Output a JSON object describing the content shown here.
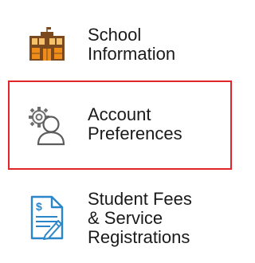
{
  "menu": {
    "items": [
      {
        "id": "school",
        "label": "School\nInformation",
        "icon": "school-building-icon"
      },
      {
        "id": "account",
        "label": "Account\nPreferences",
        "icon": "user-gear-icon",
        "highlighted": true,
        "highlight_color": "#e0262b"
      },
      {
        "id": "fees",
        "label": "Student Fees\n& Service\nRegistrations",
        "icon": "fee-document-icon"
      }
    ]
  },
  "colors": {
    "building_brown": "#7a4a1e",
    "building_orange": "#f08c1a",
    "doc_blue": "#2a86c9",
    "gray_icon": "#6d6d6d"
  }
}
